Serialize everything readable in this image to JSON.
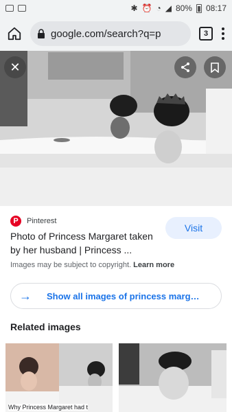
{
  "status": {
    "battery": "80%",
    "time": "08:17"
  },
  "browser": {
    "url": "google.com/search?q=p",
    "tab_count": "3"
  },
  "result": {
    "source": "Pinterest",
    "title": "Photo of Princess Margaret taken by her husband | Princess ...",
    "visit_label": "Visit",
    "copyright": "Images may be subject to copyright.",
    "learn_more": "Learn more",
    "show_all": "Show all images of princess marg…",
    "related_heading": "Related images",
    "related_caption": "Why Princess Margaret had t"
  },
  "colors": {
    "accent": "#1a73e8",
    "pinterest": "#e60023",
    "chip_bg": "#e8f0fe"
  }
}
